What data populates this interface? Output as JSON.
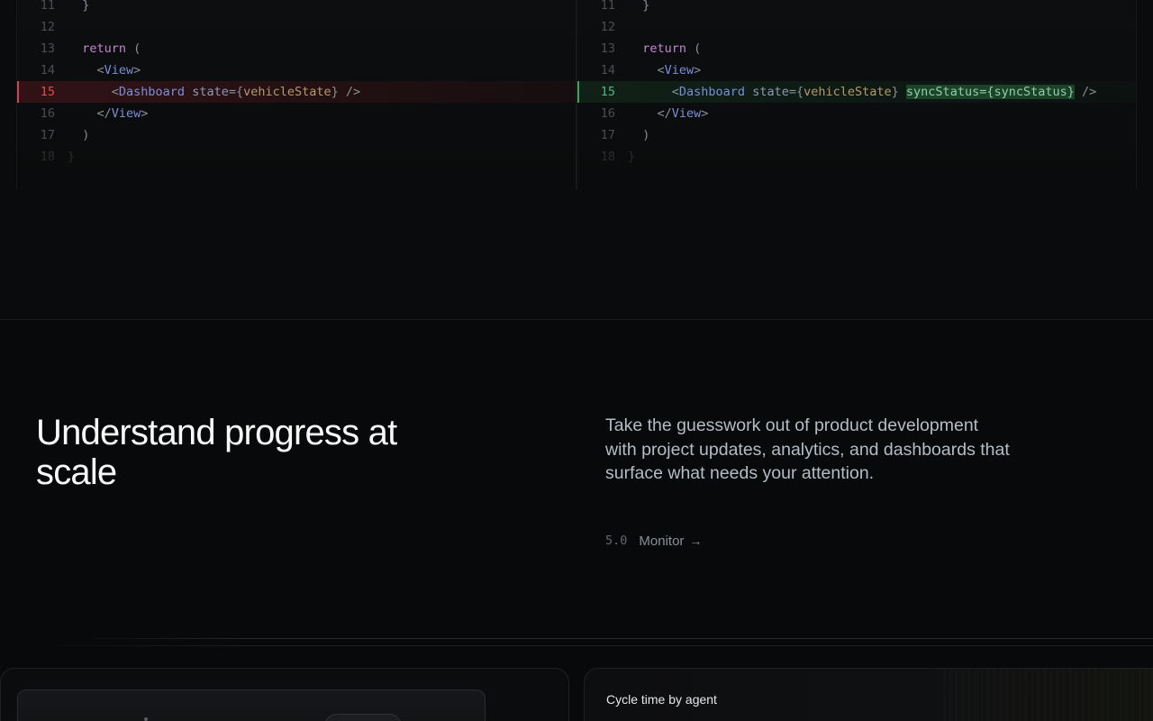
{
  "diff": {
    "left": {
      "lines": [
        {
          "num": "11",
          "type": "context",
          "tokens": [
            {
              "t": "  }",
              "c": "pun"
            }
          ]
        },
        {
          "num": "12",
          "type": "context",
          "tokens": []
        },
        {
          "num": "13",
          "type": "context",
          "tokens": [
            {
              "t": "  ",
              "c": "pun"
            },
            {
              "t": "return",
              "c": "kw"
            },
            {
              "t": " (",
              "c": "pun"
            }
          ]
        },
        {
          "num": "14",
          "type": "context",
          "tokens": [
            {
              "t": "    <",
              "c": "pun"
            },
            {
              "t": "View",
              "c": "tag"
            },
            {
              "t": ">",
              "c": "pun"
            }
          ]
        },
        {
          "num": "15",
          "type": "removed",
          "tokens": [
            {
              "t": "      <",
              "c": "pun"
            },
            {
              "t": "Dashboard",
              "c": "tag"
            },
            {
              "t": " ",
              "c": "pun"
            },
            {
              "t": "state",
              "c": "attr"
            },
            {
              "t": "={",
              "c": "pun"
            },
            {
              "t": "vehicleState",
              "c": "val"
            },
            {
              "t": "} />",
              "c": "pun"
            }
          ]
        },
        {
          "num": "16",
          "type": "context",
          "tokens": [
            {
              "t": "    </",
              "c": "pun"
            },
            {
              "t": "View",
              "c": "tag"
            },
            {
              "t": ">",
              "c": "pun"
            }
          ]
        },
        {
          "num": "17",
          "type": "context",
          "tokens": [
            {
              "t": "  )",
              "c": "pun"
            }
          ]
        },
        {
          "num": "18",
          "type": "dim",
          "tokens": [
            {
              "t": "}",
              "c": "pun"
            }
          ]
        }
      ]
    },
    "right": {
      "lines": [
        {
          "num": "11",
          "type": "context",
          "tokens": [
            {
              "t": "  }",
              "c": "pun"
            }
          ]
        },
        {
          "num": "12",
          "type": "context",
          "tokens": []
        },
        {
          "num": "13",
          "type": "context",
          "tokens": [
            {
              "t": "  ",
              "c": "pun"
            },
            {
              "t": "return",
              "c": "kw"
            },
            {
              "t": " (",
              "c": "pun"
            }
          ]
        },
        {
          "num": "14",
          "type": "context",
          "tokens": [
            {
              "t": "    <",
              "c": "pun"
            },
            {
              "t": "View",
              "c": "tag"
            },
            {
              "t": ">",
              "c": "pun"
            }
          ]
        },
        {
          "num": "15",
          "type": "added",
          "tokens": [
            {
              "t": "      <",
              "c": "pun"
            },
            {
              "t": "Dashboard",
              "c": "tag"
            },
            {
              "t": " ",
              "c": "pun"
            },
            {
              "t": "state",
              "c": "attr"
            },
            {
              "t": "={",
              "c": "pun"
            },
            {
              "t": "vehicleState",
              "c": "val"
            },
            {
              "t": "} ",
              "c": "pun"
            },
            {
              "t": "syncStatus={syncStatus}",
              "c": "hl"
            },
            {
              "t": " />",
              "c": "pun"
            }
          ]
        },
        {
          "num": "16",
          "type": "context",
          "tokens": [
            {
              "t": "    </",
              "c": "pun"
            },
            {
              "t": "View",
              "c": "tag"
            },
            {
              "t": ">",
              "c": "pun"
            }
          ]
        },
        {
          "num": "17",
          "type": "context",
          "tokens": [
            {
              "t": "  )",
              "c": "pun"
            }
          ]
        },
        {
          "num": "18",
          "type": "dim",
          "tokens": [
            {
              "t": "}",
              "c": "pun"
            }
          ]
        }
      ]
    }
  },
  "hero": {
    "title": "Understand progress at scale",
    "description": "Take the guesswork out of product development with project updates, analytics, and dashboards that surface what needs your attention.",
    "link_number": "5.0",
    "link_label": "Monitor",
    "link_arrow": "→"
  },
  "cards": {
    "right_title": "Cycle time by agent"
  },
  "colors": {
    "background": "#08090a",
    "removed": "#e5484d",
    "added": "#4cb782",
    "keyword": "#c386d0",
    "tag": "#7c8ed6"
  }
}
